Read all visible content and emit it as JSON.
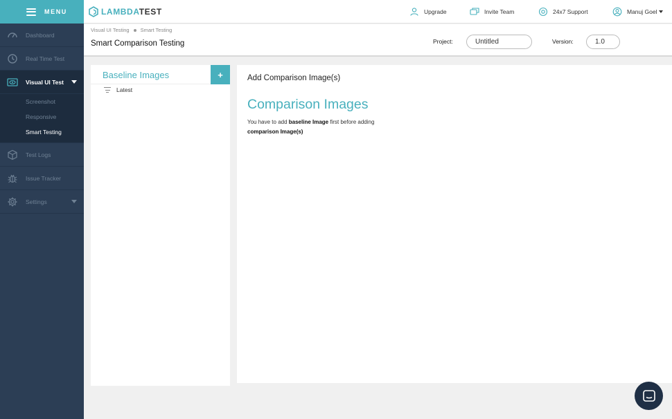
{
  "sidebar": {
    "menu_label": "MENU",
    "items": [
      {
        "label": "Dashboard",
        "icon": "dashboard-gauge-icon"
      },
      {
        "label": "Real Time Test",
        "icon": "clock-icon"
      },
      {
        "label": "Visual UI Test",
        "icon": "eye-icon",
        "active": true
      },
      {
        "label": "Test Logs",
        "icon": "cube-icon"
      },
      {
        "label": "Issue Tracker",
        "icon": "bug-icon"
      },
      {
        "label": "Settings",
        "icon": "gear-icon"
      }
    ],
    "subitems": [
      {
        "label": "Screenshot"
      },
      {
        "label": "Responsive"
      },
      {
        "label": "Smart Testing",
        "current": true
      }
    ]
  },
  "topbar": {
    "logo_left": "LAMBDA",
    "logo_right": "TEST",
    "upgrade": "Upgrade",
    "invite": "Invite Team",
    "support": "24x7 Support",
    "user": "Manuj Goel"
  },
  "header": {
    "breadcrumb": [
      "Visual UI Testing",
      "Smart Testing"
    ],
    "title": "Smart Comparison Testing",
    "project_label": "Project:",
    "project_value": "Untitled",
    "version_label": "Version:",
    "version_value": "1.0"
  },
  "baseline": {
    "title": "Baseline Images",
    "add_symbol": "+",
    "filter_label": "Latest"
  },
  "comparison": {
    "title": "Add Comparison Image(s)",
    "heading": "Comparison Images",
    "msg_1": "You have to add ",
    "msg_2": "baseline Image",
    "msg_3": " first before adding ",
    "msg_4": "comparison Image(s)"
  },
  "colors": {
    "accent": "#48b0bd",
    "sidebar": "#2c3e55",
    "sidebar_active": "#1d2c3e"
  }
}
